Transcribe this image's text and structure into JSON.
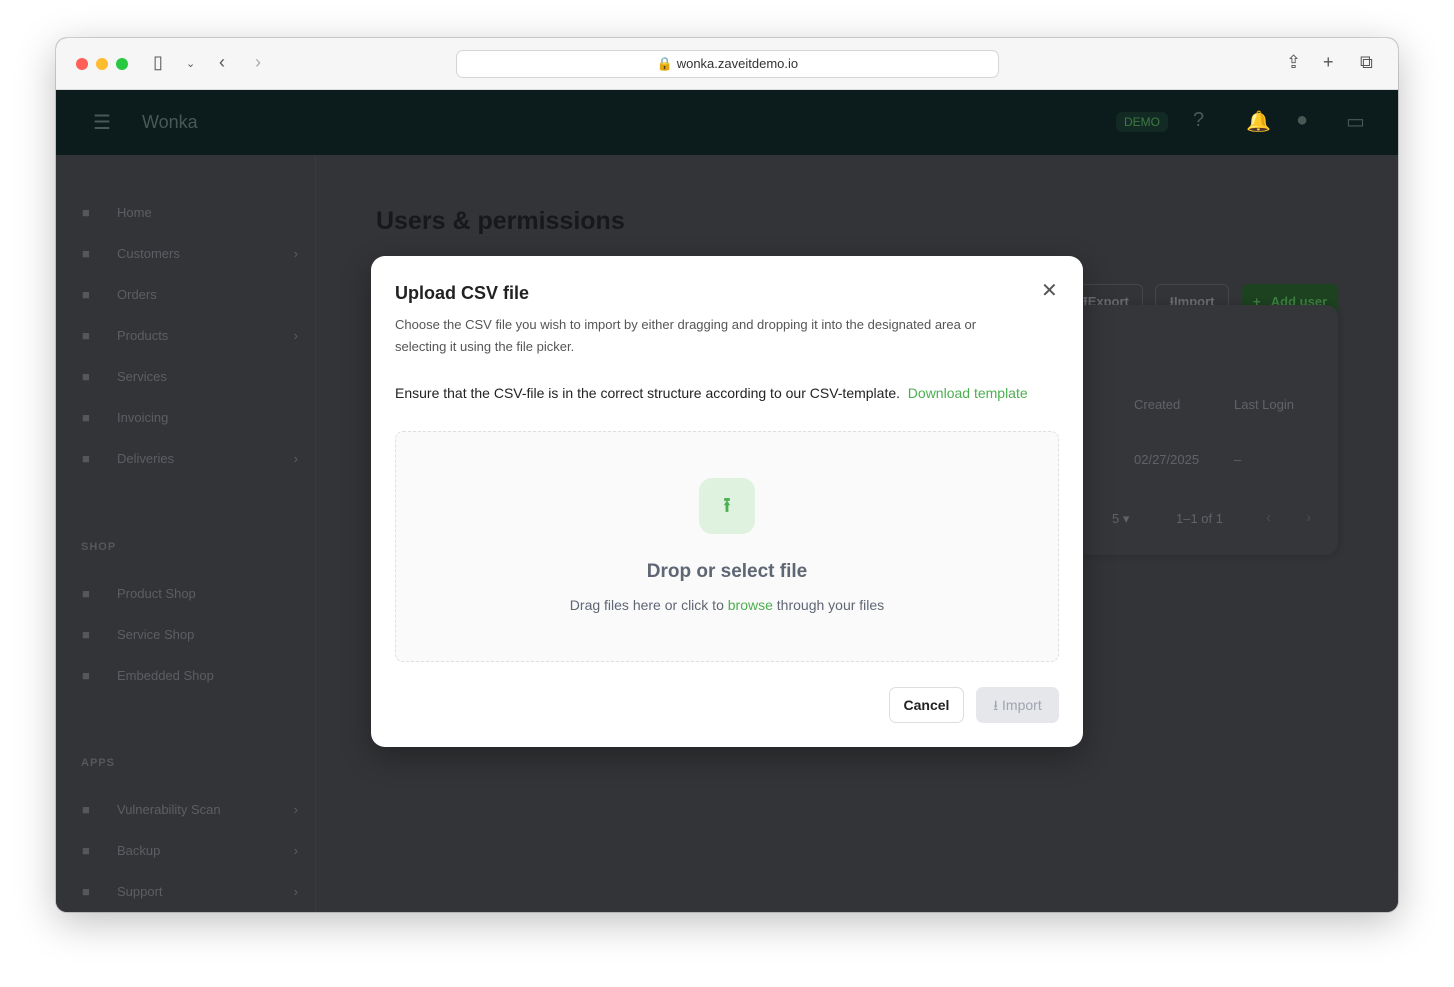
{
  "browser": {
    "url": "wonka.zaveitdemo.io"
  },
  "header": {
    "app_name": "Wonka",
    "badge": "DEMO"
  },
  "sidebar": {
    "items": [
      {
        "label": "Home",
        "icon": "home-icon",
        "chev": false
      },
      {
        "label": "Customers",
        "icon": "people-icon",
        "chev": true
      },
      {
        "label": "Orders",
        "icon": "orders-icon",
        "chev": false
      },
      {
        "label": "Products",
        "icon": "products-icon",
        "chev": true
      },
      {
        "label": "Services",
        "icon": "services-icon",
        "chev": false
      },
      {
        "label": "Invoicing",
        "icon": "invoice-icon",
        "chev": false
      },
      {
        "label": "Deliveries",
        "icon": "truck-icon",
        "chev": true
      }
    ],
    "shop_title": "SHOP",
    "shop": [
      {
        "label": "Product Shop",
        "icon": "shop-icon"
      },
      {
        "label": "Service Shop",
        "icon": "bag-icon"
      },
      {
        "label": "Embedded Shop",
        "icon": "embed-icon"
      }
    ],
    "apps_title": "APPS",
    "apps": [
      {
        "label": "Vulnerability Scan",
        "icon": "shield-icon"
      },
      {
        "label": "Backup",
        "icon": "cloud-icon"
      },
      {
        "label": "Support",
        "icon": "ticket-icon"
      }
    ]
  },
  "page": {
    "title": "Users & permissions",
    "export": "Export",
    "import": "Import",
    "add_user": "Add user",
    "table": {
      "headers": [
        "Created",
        "Last Login"
      ],
      "row": [
        "02/27/2025",
        "–"
      ],
      "rows_per_page": "5",
      "range": "1–1 of 1"
    }
  },
  "modal": {
    "title": "Upload CSV file",
    "description": "Choose the CSV file you wish to import by either dragging and dropping it into the designated area or selecting it using the file picker.",
    "ensure": "Ensure that the CSV-file is in the correct structure according to our CSV-template.",
    "download": "Download template",
    "drop_title": "Drop or select file",
    "drop_pre": "Drag files here or click to ",
    "drop_link": "browse",
    "drop_post": " through your files",
    "cancel": "Cancel",
    "import": "Import"
  },
  "colors": {
    "accent": "#4caf50",
    "header": "#1c3b37"
  }
}
